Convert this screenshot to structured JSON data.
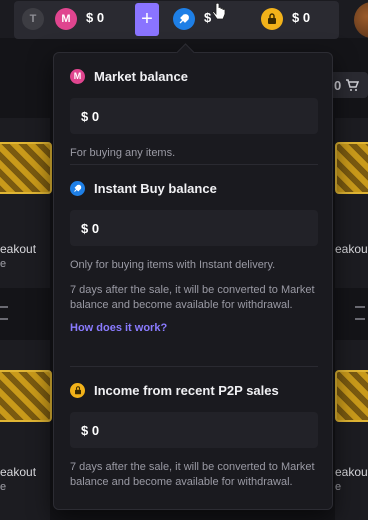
{
  "topbar": {
    "t_coin_label": "T",
    "market_coin_label": "M",
    "market_amount": "$ 0",
    "add_label": "+",
    "instant_amount": "$",
    "lock_amount": "$ 0"
  },
  "background": {
    "cart_label": "0",
    "left_card_1_title": "eakout",
    "left_card_1_sub": "e",
    "right_card_1_title": "eakout",
    "left_card_2_title": "eakout",
    "left_card_2_sub": "e",
    "right_card_2_title": "eakout",
    "right_card_2_sub": "e"
  },
  "dropdown": {
    "market": {
      "title": "Market balance",
      "amount": "$ 0",
      "desc": "For buying any items."
    },
    "instant": {
      "title": "Instant Buy balance",
      "amount": "$ 0",
      "desc": "Only for buying items with Instant delivery.",
      "desc2": "7 days after the sale, it will be converted to Market balance and become available for withdrawal.",
      "link": "How does it work?"
    },
    "p2p": {
      "title": "Income from recent P2P sales",
      "amount": "$ 0",
      "desc": "7 days after the sale, it will be converted to Market balance and become available for withdrawal."
    }
  },
  "colors": {
    "market_icon": "#e0458f",
    "instant_icon": "#1e7fe6",
    "lock_icon": "#f2b21a",
    "accent": "#8a74ff",
    "link": "#8a7bff"
  },
  "icons": {
    "t_coin": "t-coin-icon",
    "market": "market-icon",
    "instant": "rocket-icon",
    "lock": "lock-icon",
    "add": "plus-icon",
    "cart": "cart-icon",
    "cursor": "hand-cursor-icon"
  }
}
